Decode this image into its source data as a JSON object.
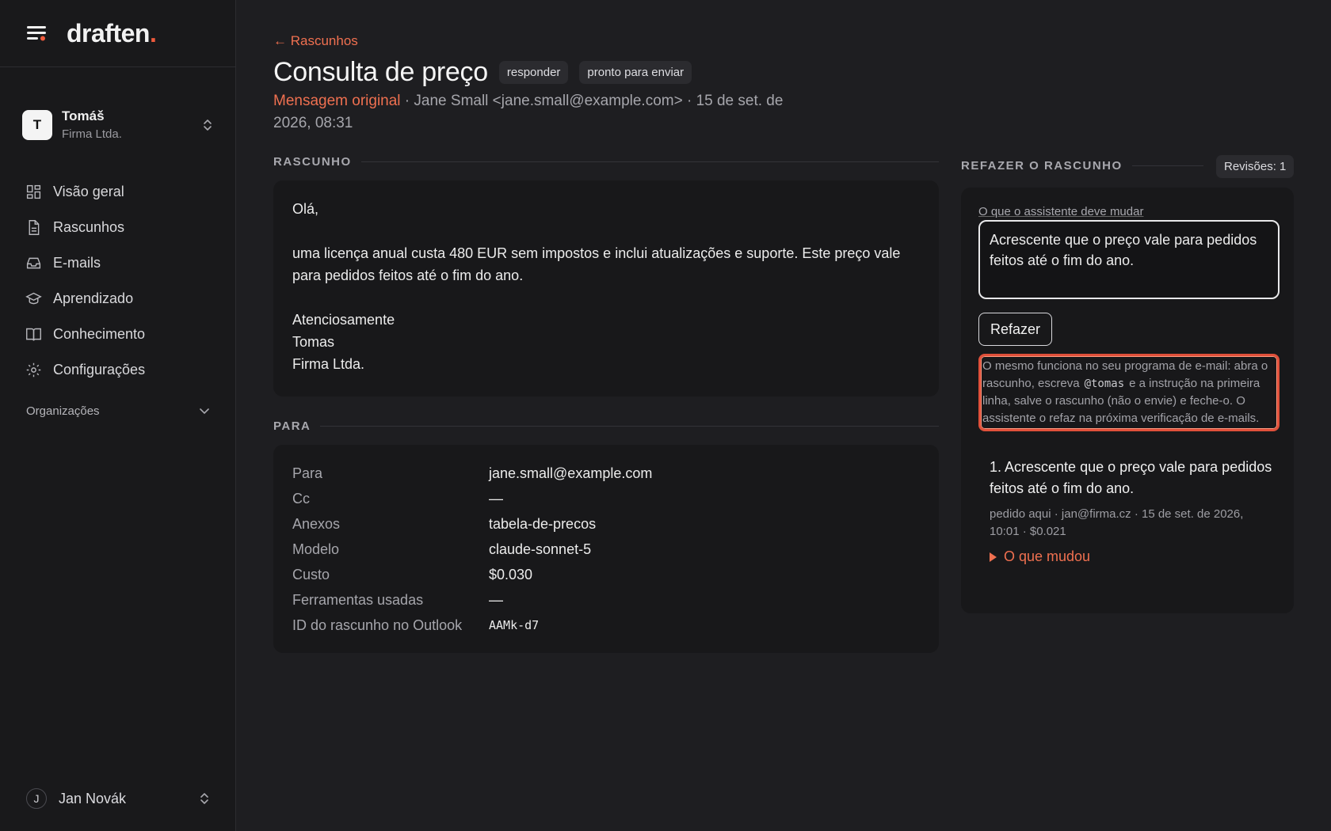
{
  "brand": {
    "name": "draften",
    "dot": "."
  },
  "account": {
    "initial": "T",
    "name": "Tomáš",
    "org": "Firma Ltda."
  },
  "nav": [
    {
      "label": "Visão geral",
      "icon": "dashboard-icon"
    },
    {
      "label": "Rascunhos",
      "icon": "document-icon"
    },
    {
      "label": "E-mails",
      "icon": "inbox-icon"
    },
    {
      "label": "Aprendizado",
      "icon": "graduation-cap-icon"
    },
    {
      "label": "Conhecimento",
      "icon": "book-icon"
    },
    {
      "label": "Configurações",
      "icon": "gear-icon"
    }
  ],
  "organizations_label": "Organizações",
  "user": {
    "initial": "J",
    "name": "Jan Novák"
  },
  "page": {
    "back": "← Rascunhos",
    "title": "Consulta de preço",
    "badges": [
      "responder",
      "pronto para enviar"
    ],
    "meta_link": "Mensagem original",
    "meta_rest": " · Jane Small <jane.small@example.com> · 15 de set. de 2026, 08:31"
  },
  "draft": {
    "label": "RASCUNHO",
    "paragraphs": [
      "Olá,",
      "uma licença anual custa 480 EUR sem impostos e inclui atualizações e suporte. Este preço vale para pedidos feitos até o fim do ano.",
      "Atenciosamente\nTomas\nFirma Ltda."
    ]
  },
  "recipients": {
    "label": "PARA",
    "rows": [
      {
        "k": "Para",
        "v": "jane.small@example.com"
      },
      {
        "k": "Cc",
        "v": "—"
      },
      {
        "k": "Anexos",
        "v": "tabela-de-precos"
      },
      {
        "k": "Modelo",
        "v": "claude-sonnet-5"
      },
      {
        "k": "Custo",
        "v": "$0.030"
      },
      {
        "k": "Ferramentas usadas",
        "v": "—"
      },
      {
        "k": "ID do rascunho no Outlook",
        "v": "AAMk-d7"
      }
    ]
  },
  "redo": {
    "label": "REFAZER O RASCUNHO",
    "revisions": "Revisões: 1",
    "field_label": "O que o assistente deve mudar",
    "instruction": "Acrescente que o preço vale para pedidos feitos até o fim do ano.",
    "button": "Refazer",
    "hint_before": "O mesmo funciona no seu programa de e-mail: abra o rascunho, escreva",
    "hint_code": "@tomas",
    "hint_after": "e a instrução na primeira linha, salve o rascunho (não o envie) e feche-o. O assistente o refaz na próxima verificação de e-mails.",
    "item_title": "1. Acrescente que o preço vale para pedidos feitos até o fim do ano.",
    "item_meta": "pedido aqui · jan@firma.cz · 15 de set. de 2026, 10:01 · $0.021",
    "changed": "O que mudou"
  },
  "colors": {
    "accent": "#ef7050",
    "highlight": "#e0503a",
    "bg": "#1e1e21",
    "card": "#18181a"
  }
}
